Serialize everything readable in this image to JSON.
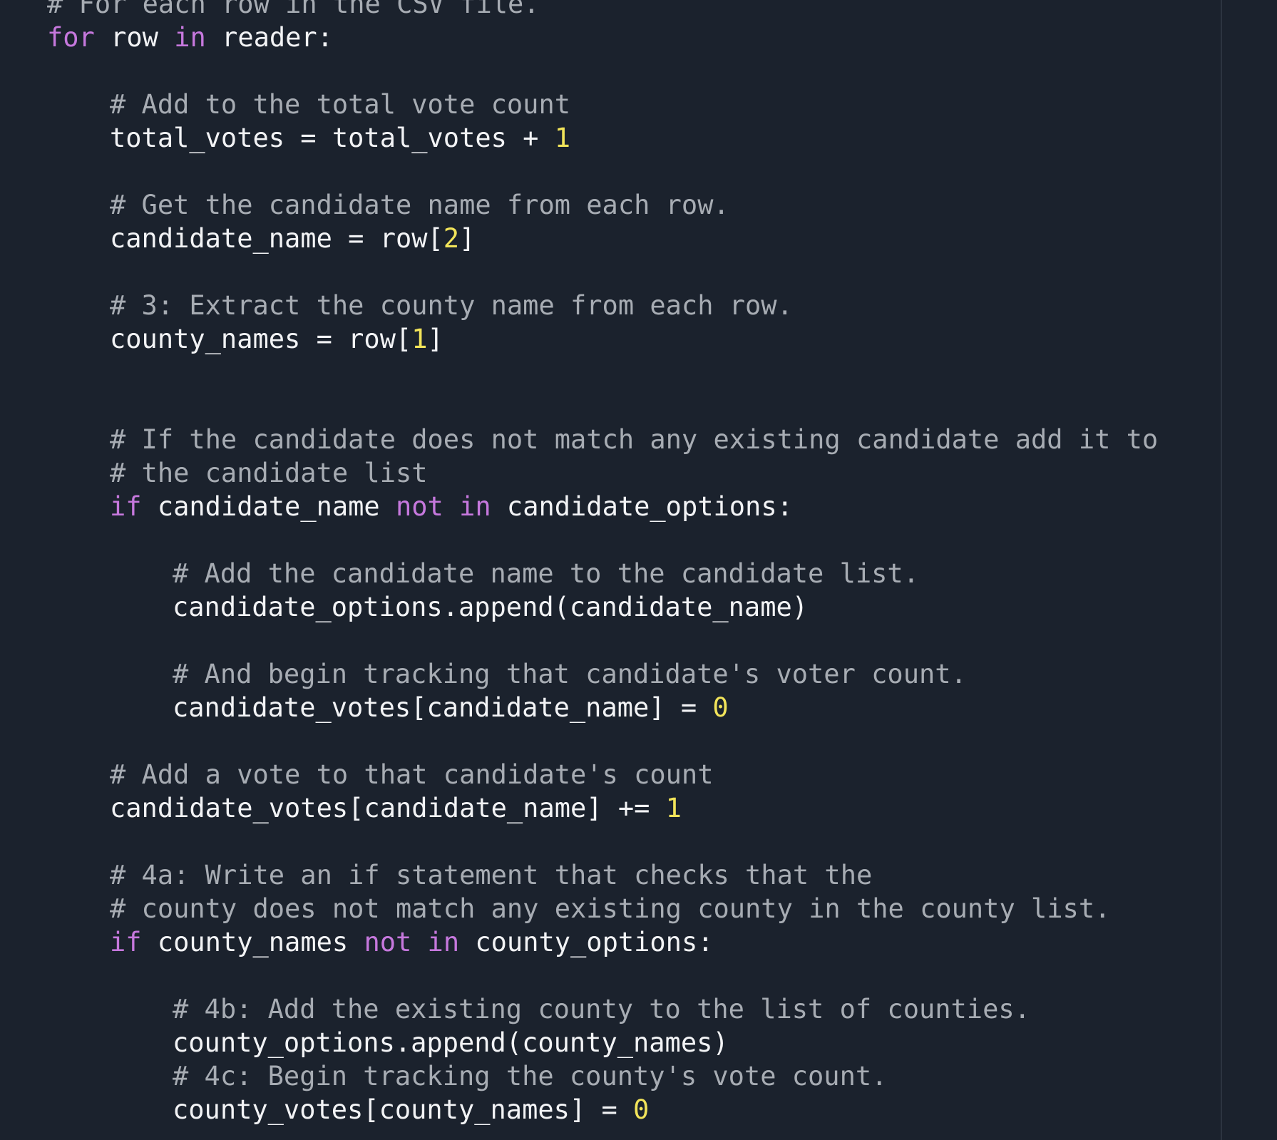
{
  "theme": {
    "background": "#1b222d",
    "text": "#f2f3f5",
    "comment": "#a7acb3",
    "keyword": "#c678dd",
    "number": "#f2e45a",
    "ruler": "#2c3440"
  },
  "code": {
    "language": "python",
    "lines": [
      {
        "indent": 0,
        "tokens": [
          {
            "t": "comment",
            "v": "# For each row in the CSV file."
          }
        ]
      },
      {
        "indent": 0,
        "tokens": [
          {
            "t": "keyword",
            "v": "for"
          },
          {
            "t": "ident",
            "v": " row "
          },
          {
            "t": "keyword",
            "v": "in"
          },
          {
            "t": "ident",
            "v": " reader:"
          }
        ]
      },
      {
        "indent": 0,
        "tokens": []
      },
      {
        "indent": 1,
        "tokens": [
          {
            "t": "comment",
            "v": "# Add to the total vote count"
          }
        ]
      },
      {
        "indent": 1,
        "tokens": [
          {
            "t": "ident",
            "v": "total_votes = total_votes + "
          },
          {
            "t": "number",
            "v": "1"
          }
        ]
      },
      {
        "indent": 0,
        "tokens": []
      },
      {
        "indent": 1,
        "tokens": [
          {
            "t": "comment",
            "v": "# Get the candidate name from each row."
          }
        ]
      },
      {
        "indent": 1,
        "tokens": [
          {
            "t": "ident",
            "v": "candidate_name = row["
          },
          {
            "t": "number",
            "v": "2"
          },
          {
            "t": "ident",
            "v": "]"
          }
        ]
      },
      {
        "indent": 0,
        "tokens": []
      },
      {
        "indent": 1,
        "tokens": [
          {
            "t": "comment",
            "v": "# 3: Extract the county name from each row."
          }
        ]
      },
      {
        "indent": 1,
        "tokens": [
          {
            "t": "ident",
            "v": "county_names = row["
          },
          {
            "t": "number",
            "v": "1"
          },
          {
            "t": "ident",
            "v": "]"
          }
        ]
      },
      {
        "indent": 0,
        "tokens": []
      },
      {
        "indent": 0,
        "tokens": []
      },
      {
        "indent": 1,
        "tokens": [
          {
            "t": "comment",
            "v": "# If the candidate does not match any existing candidate add it to"
          }
        ]
      },
      {
        "indent": 1,
        "tokens": [
          {
            "t": "comment",
            "v": "# the candidate list"
          }
        ]
      },
      {
        "indent": 1,
        "tokens": [
          {
            "t": "keyword",
            "v": "if"
          },
          {
            "t": "ident",
            "v": " candidate_name "
          },
          {
            "t": "keyword",
            "v": "not in"
          },
          {
            "t": "ident",
            "v": " candidate_options:"
          }
        ]
      },
      {
        "indent": 0,
        "tokens": []
      },
      {
        "indent": 2,
        "tokens": [
          {
            "t": "comment",
            "v": "# Add the candidate name to the candidate list."
          }
        ]
      },
      {
        "indent": 2,
        "tokens": [
          {
            "t": "ident",
            "v": "candidate_options.append(candidate_name)"
          }
        ]
      },
      {
        "indent": 0,
        "tokens": []
      },
      {
        "indent": 2,
        "tokens": [
          {
            "t": "comment",
            "v": "# And begin tracking that candidate's voter count."
          }
        ]
      },
      {
        "indent": 2,
        "tokens": [
          {
            "t": "ident",
            "v": "candidate_votes[candidate_name] = "
          },
          {
            "t": "number",
            "v": "0"
          }
        ]
      },
      {
        "indent": 0,
        "tokens": []
      },
      {
        "indent": 1,
        "tokens": [
          {
            "t": "comment",
            "v": "# Add a vote to that candidate's count"
          }
        ]
      },
      {
        "indent": 1,
        "tokens": [
          {
            "t": "ident",
            "v": "candidate_votes[candidate_name] += "
          },
          {
            "t": "number",
            "v": "1"
          }
        ]
      },
      {
        "indent": 0,
        "tokens": []
      },
      {
        "indent": 1,
        "tokens": [
          {
            "t": "comment",
            "v": "# 4a: Write an if statement that checks that the"
          }
        ]
      },
      {
        "indent": 1,
        "tokens": [
          {
            "t": "comment",
            "v": "# county does not match any existing county in the county list."
          }
        ]
      },
      {
        "indent": 1,
        "tokens": [
          {
            "t": "keyword",
            "v": "if"
          },
          {
            "t": "ident",
            "v": " county_names "
          },
          {
            "t": "keyword",
            "v": "not in"
          },
          {
            "t": "ident",
            "v": " county_options:"
          }
        ]
      },
      {
        "indent": 0,
        "tokens": []
      },
      {
        "indent": 2,
        "tokens": [
          {
            "t": "comment",
            "v": "# 4b: Add the existing county to the list of counties."
          }
        ]
      },
      {
        "indent": 2,
        "tokens": [
          {
            "t": "ident",
            "v": "county_options.append(county_names)"
          }
        ]
      },
      {
        "indent": 2,
        "tokens": [
          {
            "t": "comment",
            "v": "# 4c: Begin tracking the county's vote count."
          }
        ]
      },
      {
        "indent": 2,
        "tokens": [
          {
            "t": "ident",
            "v": "county_votes[county_names] = "
          },
          {
            "t": "number",
            "v": "0"
          }
        ]
      }
    ]
  }
}
